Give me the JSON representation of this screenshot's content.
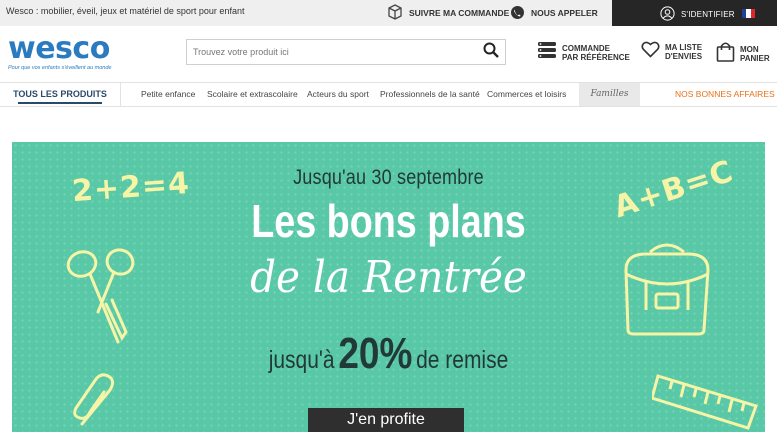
{
  "topbar": {
    "tagline": "Wesco : mobilier, éveil, jeux et matériel de sport pour enfant",
    "track_order": "SUIVRE MA COMMANDE",
    "call_us": "NOUS APPELER",
    "login": "S'IDENTIFIER"
  },
  "header": {
    "logo_text": "wesco",
    "logo_baseline": "Pour que vos enfants s'éveillent au monde",
    "search_placeholder": "Trouvez votre produit ici",
    "order_by_ref_line1": "COMMANDE",
    "order_by_ref_line2": "PAR RÉFÉRENCE",
    "wishlist_line1": "MA LISTE",
    "wishlist_line2": "D'ENVIES",
    "cart_line1": "MON",
    "cart_line2": "PANIER"
  },
  "nav": {
    "all_products": "TOUS LES PRODUITS",
    "items": [
      "Petite enfance",
      "Scolaire et extrascolaire",
      "Acteurs du sport",
      "Professionnels de la santé",
      "Commerces et loisirs"
    ],
    "families": "Familles",
    "deals": "NOS BONNES AFFAIRES"
  },
  "banner": {
    "line1": "Jusqu'au 30 septembre",
    "line2": "Les bons plans",
    "line3": "de la Rentrée",
    "line4_pre": "jusqu'à",
    "line4_value": "20%",
    "line4_post": "de remise",
    "cta": "J'en profite",
    "doodle_left": "2+2=4",
    "doodle_right": "A+B=C"
  },
  "colors": {
    "brand_blue": "#2a7bc0",
    "banner_green": "#59c8a6",
    "deals_orange": "#e8701a",
    "account_bar": "#262626"
  }
}
